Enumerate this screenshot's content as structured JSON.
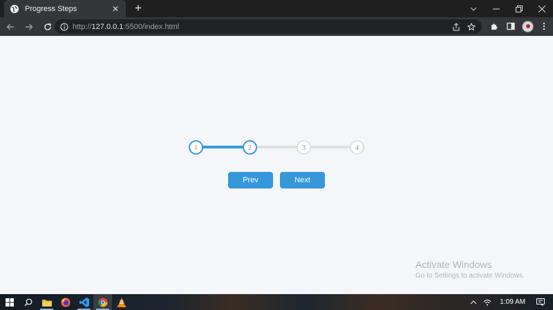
{
  "browser": {
    "tab_title": "Progress Steps",
    "tab_close": "✕",
    "new_tab": "+",
    "url_prefix": "http://",
    "url_host": "127.0.0.1",
    "url_rest": ":5500/index.html"
  },
  "progress": {
    "steps": [
      "1",
      "2",
      "3",
      "4"
    ],
    "current_step": 2,
    "fill_fraction": 0.333,
    "active_color": "#3498db",
    "inactive_color": "#e0e0e0"
  },
  "controls": {
    "prev_label": "Prev",
    "next_label": "Next"
  },
  "watermark": {
    "title": "Activate Windows",
    "subtitle": "Go to Settings to activate Windows."
  },
  "taskbar": {
    "apps": [
      "file-explorer-icon",
      "firefox-icon",
      "vscode-icon",
      "chrome-icon",
      "vlc-icon"
    ],
    "time": "1:09 AM"
  }
}
